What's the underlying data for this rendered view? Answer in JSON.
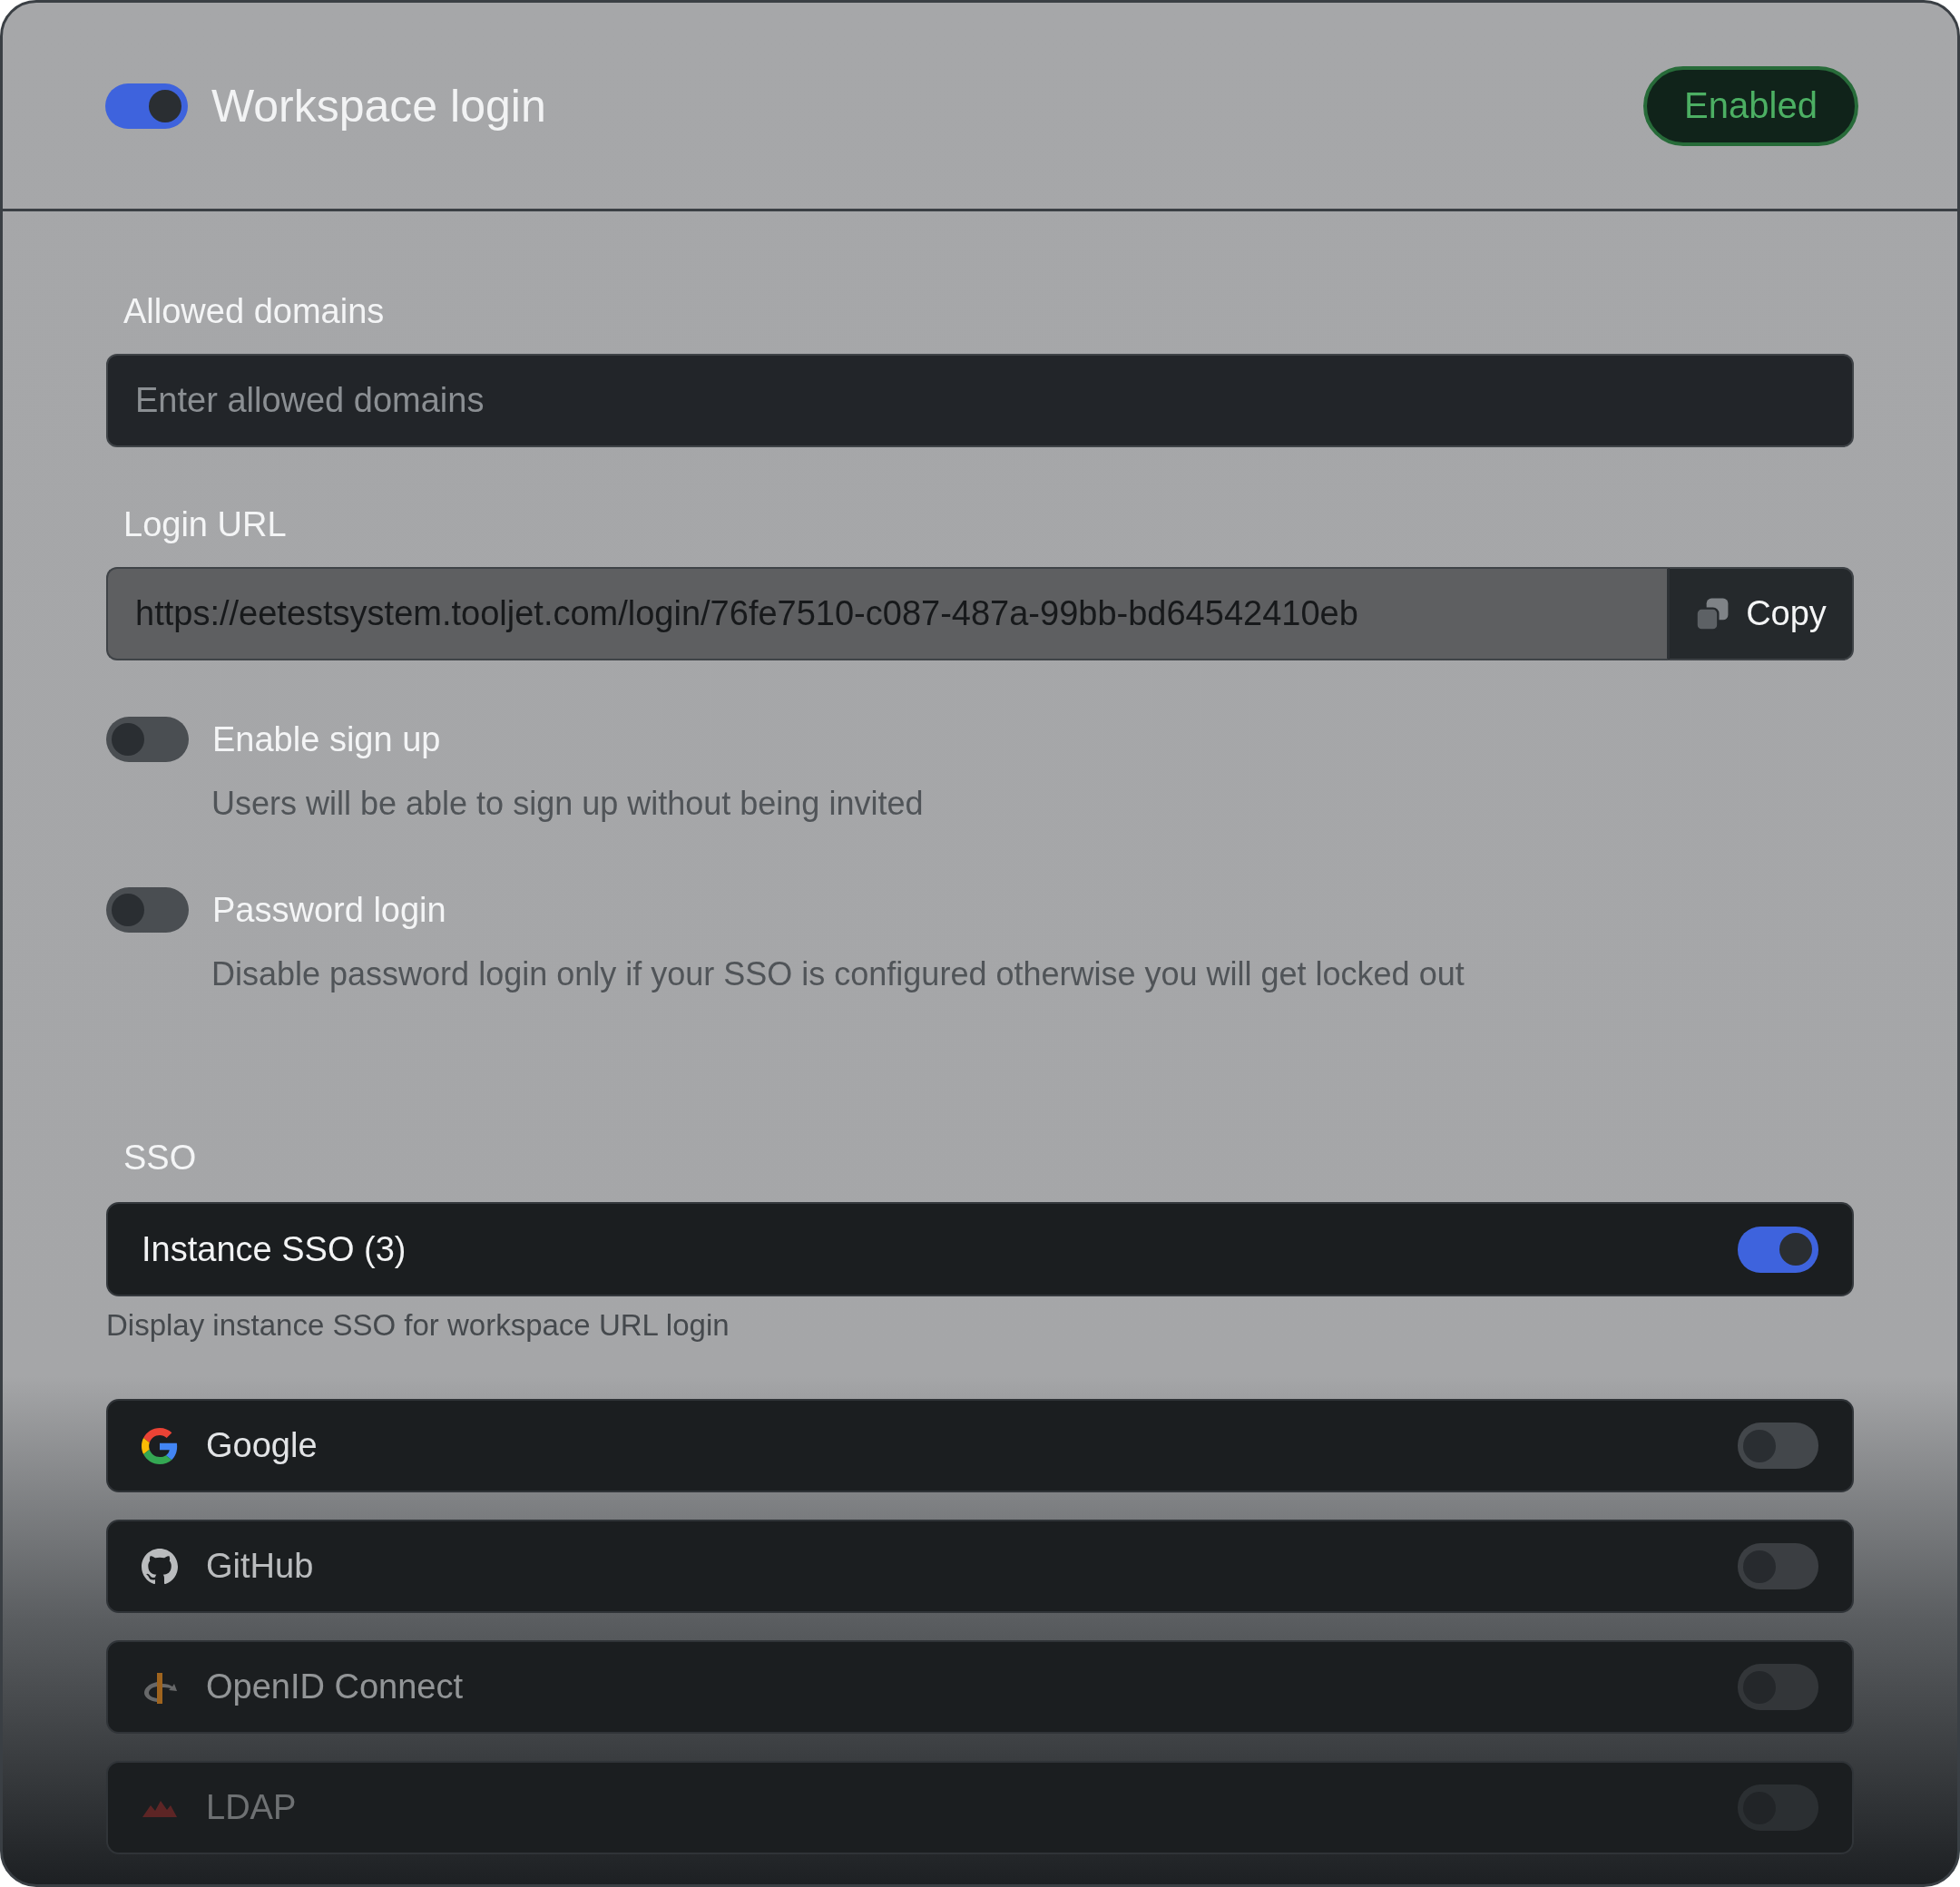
{
  "header": {
    "toggle": {
      "on": true
    },
    "title": "Workspace login",
    "status_badge": "Enabled"
  },
  "allowed_domains": {
    "label": "Allowed domains",
    "placeholder": "Enter allowed domains"
  },
  "login_url": {
    "label": "Login URL",
    "value": "https://eetestsystem.tooljet.com/login/76fe7510-c087-487a-99bb-bd64542410eb",
    "disabled": true,
    "copy_button": "Copy"
  },
  "options": [
    {
      "label": "Enable sign up",
      "on": false,
      "hint": "Users will be able to sign up without being invited"
    },
    {
      "label": "Password login",
      "on": false,
      "hint": "Disable password login only if your SSO is configured otherwise you will get locked out"
    }
  ],
  "sso": {
    "heading": "SSO",
    "instance": {
      "label": "Instance SSO (3)",
      "on": true
    },
    "hint": "Display instance SSO for workspace URL login",
    "providers": [
      {
        "kind": "google",
        "label": "Google",
        "on": false
      },
      {
        "kind": "github",
        "label": "GitHub",
        "on": false
      },
      {
        "kind": "openid",
        "label": "OpenID Connect",
        "on": false
      },
      {
        "kind": "ldap",
        "label": "LDAP",
        "on": false
      }
    ]
  }
}
